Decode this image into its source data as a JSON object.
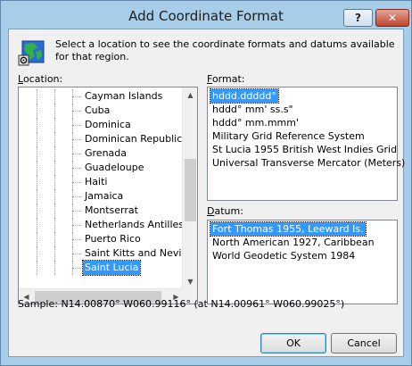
{
  "window": {
    "title": "Add Coordinate Format",
    "help_label": "?",
    "close_label": "✕"
  },
  "instruction": "Select a location to see the coordinate formats and datums available for that region.",
  "location": {
    "label_underlined": "L",
    "label_rest": "ocation:",
    "items": [
      {
        "label": "Cayman Islands",
        "selected": false
      },
      {
        "label": "Cuba",
        "selected": false
      },
      {
        "label": "Dominica",
        "selected": false
      },
      {
        "label": "Dominican Republic",
        "selected": false
      },
      {
        "label": "Grenada",
        "selected": false
      },
      {
        "label": "Guadeloupe",
        "selected": false
      },
      {
        "label": "Haiti",
        "selected": false
      },
      {
        "label": "Jamaica",
        "selected": false
      },
      {
        "label": "Montserrat",
        "selected": false
      },
      {
        "label": "Netherlands Antilles",
        "selected": false
      },
      {
        "label": "Puerto Rico",
        "selected": false
      },
      {
        "label": "Saint Kitts and Nevis",
        "selected": false
      },
      {
        "label": "Saint Lucia",
        "selected": true
      }
    ]
  },
  "format": {
    "label_underlined": "F",
    "label_rest": "ormat:",
    "items": [
      {
        "label": "hddd.ddddd°",
        "selected": true
      },
      {
        "label": "hddd° mm' ss.s\"",
        "selected": false
      },
      {
        "label": "hddd° mm.mmm'",
        "selected": false
      },
      {
        "label": "Military Grid Reference System",
        "selected": false
      },
      {
        "label": "St Lucia 1955 British West Indies Grid",
        "selected": false
      },
      {
        "label": "Universal Transverse Mercator (Meters)",
        "selected": false
      }
    ]
  },
  "datum": {
    "label_underlined": "D",
    "label_rest": "atum:",
    "items": [
      {
        "label": "Fort Thomas 1955, Leeward Is.",
        "selected": true
      },
      {
        "label": "North American 1927, Caribbean",
        "selected": false
      },
      {
        "label": "World Geodetic System 1984",
        "selected": false
      }
    ]
  },
  "sample": "Sample: N14.00870°  W060.99116°  (at N14.00961°  W060.99025°)",
  "buttons": {
    "ok": "OK",
    "cancel": "Cancel"
  },
  "scroll_glyphs": {
    "up": "▲",
    "down": "▼",
    "left": "◀",
    "right": "▶"
  }
}
